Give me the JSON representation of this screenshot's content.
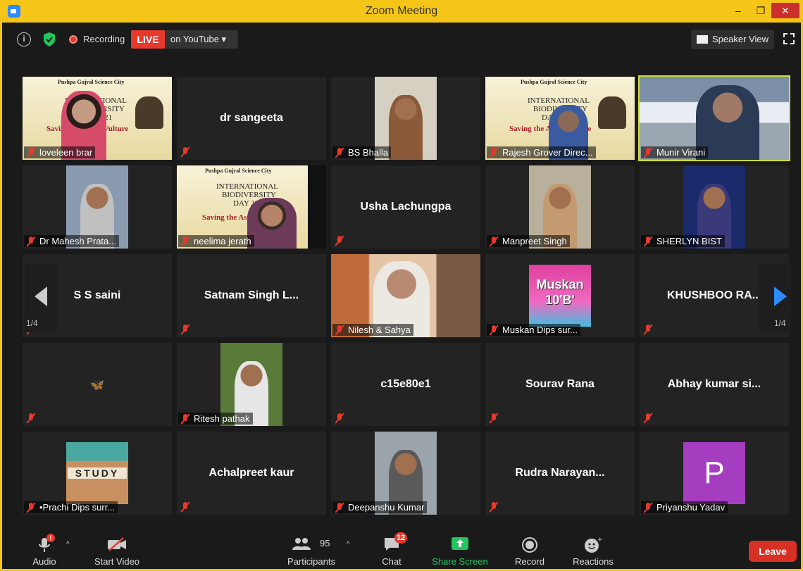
{
  "window": {
    "title": "Zoom Meeting",
    "minimize": "–",
    "maximize": "❐",
    "close": "✕"
  },
  "topbar": {
    "recording": "Recording",
    "live": "LIVE",
    "live_dest": "on YouTube ▾",
    "speaker_view": "Speaker View"
  },
  "participants_grid": {
    "page_indicator": "1/4",
    "tiles": [
      {
        "name": "loveleen brar",
        "video": true,
        "display_text": ""
      },
      {
        "name": "dr sangeeta",
        "video": false,
        "display_text": "dr sangeeta"
      },
      {
        "name": "BS Bhalla",
        "video": true,
        "display_text": ""
      },
      {
        "name": "Rajesh Grover Direc...",
        "video": true,
        "display_text": ""
      },
      {
        "name": "Munir Virani",
        "video": true,
        "display_text": "",
        "active_speaker": true
      },
      {
        "name": "Dr Mahesh Prata...",
        "video": true,
        "display_text": ""
      },
      {
        "name": "neelima jerath",
        "video": true,
        "display_text": ""
      },
      {
        "name": "",
        "video": false,
        "display_text": "Usha Lachungpa"
      },
      {
        "name": "Manpreet Singh",
        "video": true,
        "display_text": ""
      },
      {
        "name": "SHERLYN BIST",
        "video": true,
        "display_text": ""
      },
      {
        "name": "",
        "video": false,
        "display_text": "S S saini"
      },
      {
        "name": "",
        "video": false,
        "display_text": "Satnam  Singh  L..."
      },
      {
        "name": "Nilesh & Sahya",
        "video": true,
        "display_text": ""
      },
      {
        "name": "Muskan Dips sur...",
        "video": true,
        "display_text": ""
      },
      {
        "name": "",
        "video": false,
        "display_text": "KHUSHBOO   RA..."
      },
      {
        "name": "",
        "video": false,
        "display_text": "🦋"
      },
      {
        "name": "Ritesh pathak",
        "video": true,
        "display_text": ""
      },
      {
        "name": "",
        "video": false,
        "display_text": "c15e80e1"
      },
      {
        "name": "",
        "video": false,
        "display_text": "Sourav Rana"
      },
      {
        "name": "",
        "video": false,
        "display_text": "Abhay  kumar  si..."
      },
      {
        "name": "•Prachi Dips surr...",
        "video": true,
        "display_text": ""
      },
      {
        "name": "",
        "video": false,
        "display_text": "Achalpreet kaur"
      },
      {
        "name": "Deepanshu Kumar",
        "video": true,
        "display_text": ""
      },
      {
        "name": "",
        "video": false,
        "display_text": "Rudra   Narayan..."
      },
      {
        "name": "Priyanshu Yadav",
        "video": true,
        "display_text": "",
        "avatar_letter": "P"
      }
    ],
    "slide_text": {
      "header": "Pushpa Gujral Science City",
      "line1": "INTERNATIONAL",
      "line2": "BIODIVERSITY",
      "line3": "DAY 2021",
      "webinar": "Saving the Asian Vulture"
    },
    "muskan_card": {
      "line1": "Muskan",
      "line2": "10'B'"
    },
    "study_tile": "STUDY"
  },
  "toolbar": {
    "audio": "Audio",
    "start_video": "Start Video",
    "participants": "Participants",
    "participant_count": "95",
    "chat": "Chat",
    "chat_badge": "12",
    "share_screen": "Share Screen",
    "record": "Record",
    "reactions": "Reactions",
    "leave": "Leave",
    "audio_alert": "!"
  },
  "colors": {
    "title_bar": "#f5c518",
    "active_border": "#cddc39",
    "live": "#e8392d",
    "share": "#23c55e",
    "leave": "#d93025",
    "next_arrow": "#2d8cff"
  }
}
